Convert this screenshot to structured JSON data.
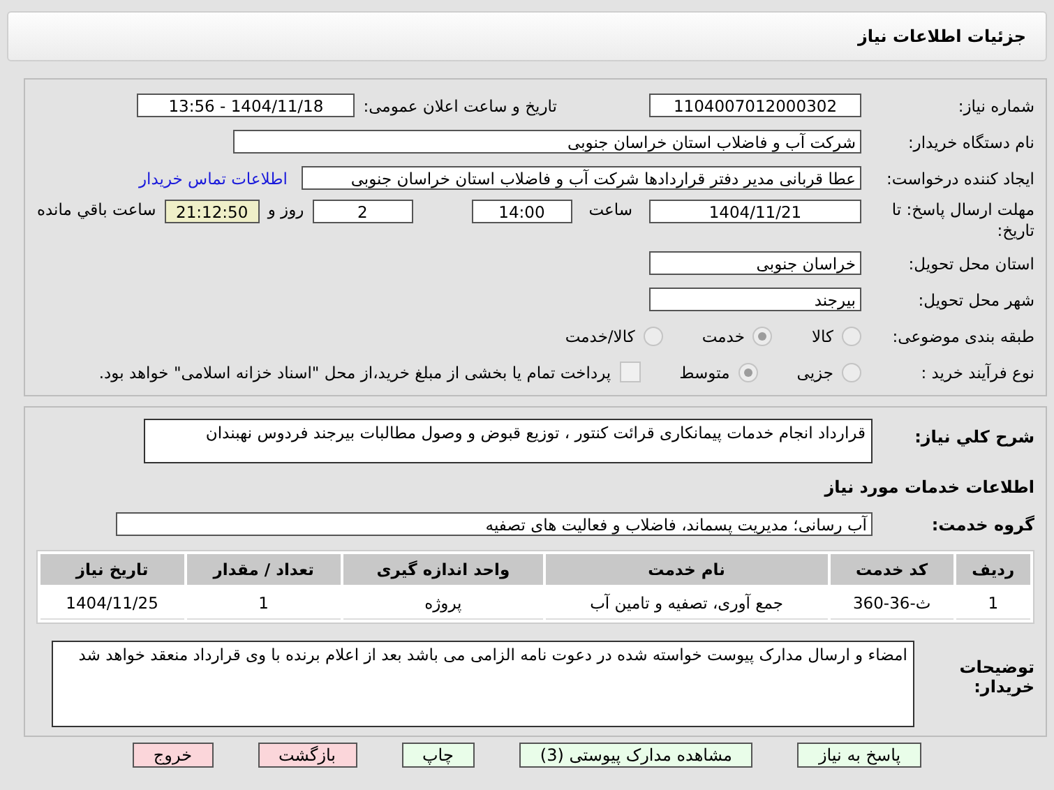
{
  "header": {
    "title": "جزئیات اطلاعات نیاز"
  },
  "need_number": {
    "label": "شماره نیاز:",
    "value": "1104007012000302"
  },
  "announce": {
    "label": "تاریخ و ساعت اعلان عمومی:",
    "value": "1404/11/18 - 13:56"
  },
  "buyer": {
    "label": "نام دستگاه خریدار:",
    "value": "شرکت آب و فاضلاب استان خراسان جنوبی"
  },
  "requester": {
    "label": "ایجاد کننده درخواست:",
    "value": "عطا قربانی مدیر دفتر قراردادها شرکت آب و فاضلاب استان خراسان جنوبی",
    "link": "اطلاعات تماس خریدار"
  },
  "deadline": {
    "label": "مهلت ارسال پاسخ: تا تاریخ:",
    "date": "1404/11/21",
    "time_label": "ساعت",
    "time": "14:00",
    "days": "2",
    "days_label": "روز و",
    "remaining": "21:12:50",
    "remaining_label": "ساعت باقي مانده"
  },
  "province": {
    "label": "استان محل تحویل:",
    "value": "خراسان جنوبی"
  },
  "city": {
    "label": "شهر محل تحویل:",
    "value": "بیرجند"
  },
  "category": {
    "label": "طبقه بندی موضوعی:",
    "options": [
      {
        "label": "کالا",
        "selected": false
      },
      {
        "label": "خدمت",
        "selected": true
      },
      {
        "label": "کالا/خدمت",
        "selected": false
      }
    ]
  },
  "process": {
    "label": "نوع فرآیند خرید :",
    "options": [
      {
        "label": "جزیی",
        "selected": false
      },
      {
        "label": "متوسط",
        "selected": true
      }
    ],
    "payment_checked": false,
    "payment_text": "پرداخت تمام یا بخشی از مبلغ خرید،از محل \"اسناد خزانه اسلامی\" خواهد بود."
  },
  "description": {
    "label": "شرح کلي نياز:",
    "value": "قرارداد انجام خدمات پیمانکاری قرائت کنتور ، توزیع قبوض و وصول مطالبات بیرجند فردوس نهبندان"
  },
  "services_title": "اطلاعات خدمات مورد نیاز",
  "service_group": {
    "label": "گروه خدمت:",
    "value": "آب رسانی؛ مدیریت پسماند، فاضلاب و فعالیت های تصفیه"
  },
  "table": {
    "columns": [
      "ردیف",
      "کد خدمت",
      "نام خدمت",
      "واحد اندازه گیری",
      "تعداد / مقدار",
      "تاریخ نیاز"
    ],
    "rows": [
      [
        "1",
        "ث-36-360",
        "جمع آوری، تصفیه و تامین آب",
        "پروژه",
        "1",
        "1404/11/25"
      ]
    ]
  },
  "notes": {
    "label": "توضیحات خریدار:",
    "value": "امضاء و ارسال مدارک پیوست خواسته شده در دعوت نامه الزامی می باشد بعد از اعلام برنده با وی قرارداد منعقد خواهد شد"
  },
  "buttons": [
    {
      "label": "پاسخ به نیاز",
      "kind": "primary"
    },
    {
      "label": "مشاهده مدارک پیوستی (3)",
      "kind": "primary"
    },
    {
      "label": "چاپ",
      "kind": "primary"
    },
    {
      "label": "بازگشت",
      "kind": "danger"
    },
    {
      "label": "خروج",
      "kind": "danger"
    }
  ]
}
